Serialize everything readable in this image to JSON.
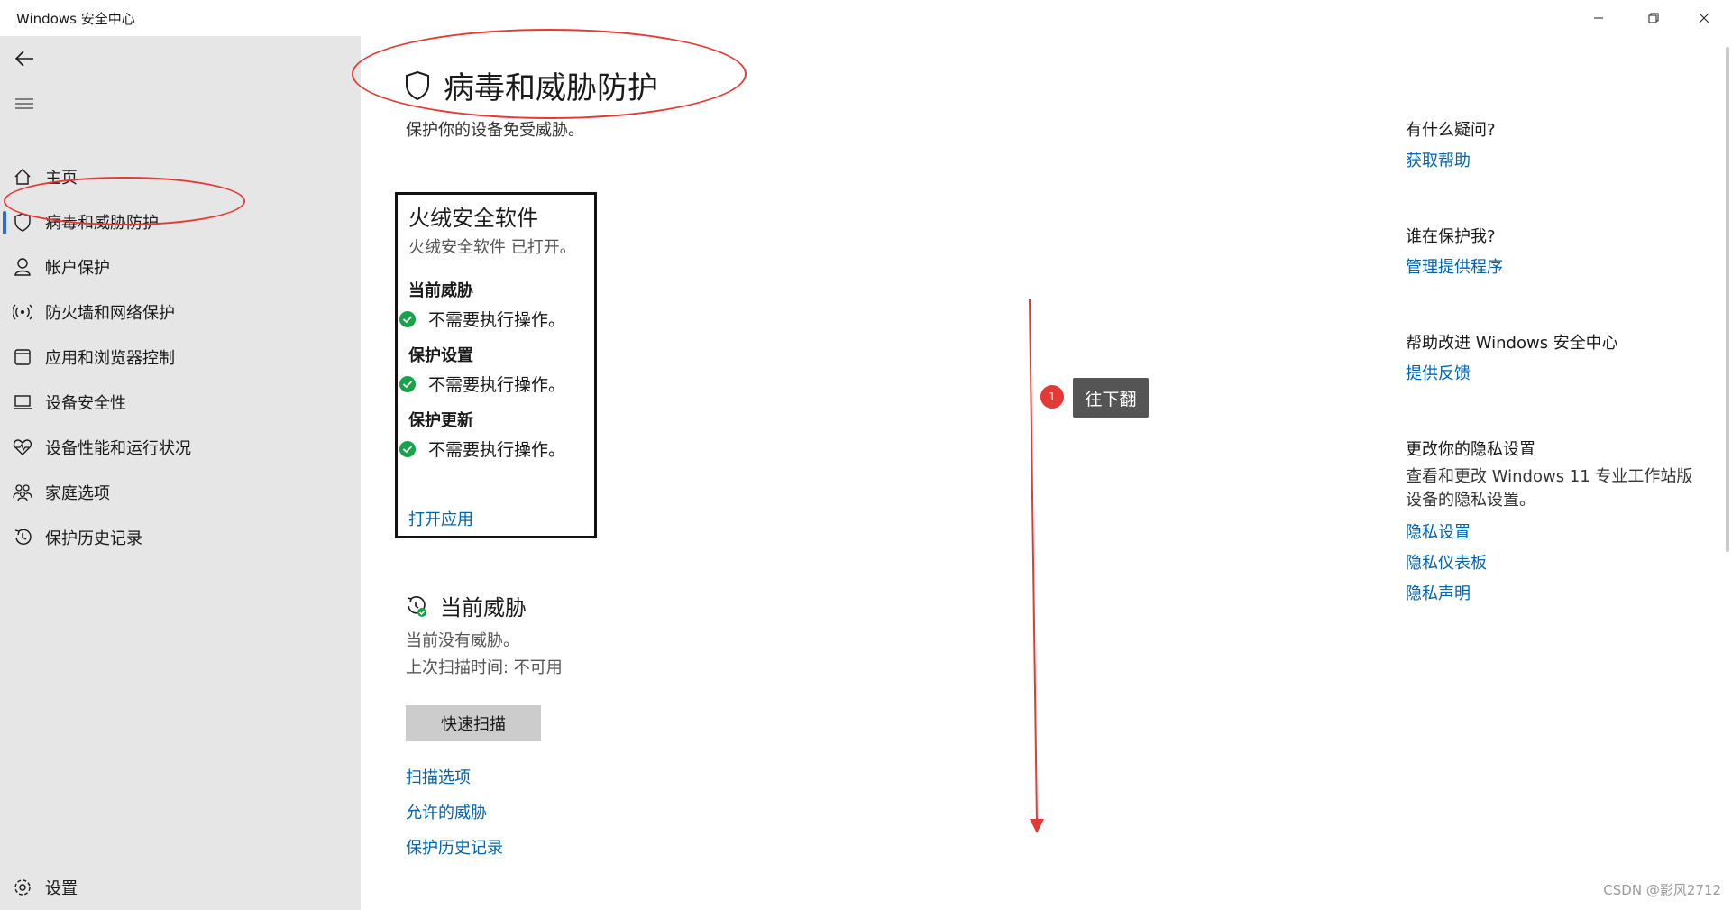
{
  "window": {
    "title": "Windows 安全中心"
  },
  "sidebar": {
    "items": [
      {
        "label": "主页",
        "icon": "home-icon"
      },
      {
        "label": "病毒和威胁防护",
        "icon": "shield-icon",
        "active": true
      },
      {
        "label": "帐户保护",
        "icon": "person-icon"
      },
      {
        "label": "防火墙和网络保护",
        "icon": "wifi-icon"
      },
      {
        "label": "应用和浏览器控制",
        "icon": "app-browser-icon"
      },
      {
        "label": "设备安全性",
        "icon": "laptop-icon"
      },
      {
        "label": "设备性能和运行状况",
        "icon": "heart-pulse-icon"
      },
      {
        "label": "家庭选项",
        "icon": "family-icon"
      },
      {
        "label": "保护历史记录",
        "icon": "history-icon"
      }
    ],
    "settings_label": "设置"
  },
  "main": {
    "title": "病毒和威胁防护",
    "subtitle": "保护你的设备免受威胁。",
    "provider": {
      "name": "火绒安全软件",
      "status": "火绒安全软件 已打开。",
      "sections": [
        {
          "heading": "当前威胁",
          "status": "不需要执行操作。"
        },
        {
          "heading": "保护设置",
          "status": "不需要执行操作。"
        },
        {
          "heading": "保护更新",
          "status": "不需要执行操作。"
        }
      ],
      "open_app_link": "打开应用"
    },
    "threats": {
      "title": "当前威胁",
      "line1": "当前没有威胁。",
      "line2": "上次扫描时间: 不可用",
      "quick_scan": "快速扫描",
      "links": [
        "扫描选项",
        "允许的威胁",
        "保护历史记录"
      ]
    }
  },
  "annotation": {
    "badge": "1",
    "tooltip": "往下翻",
    "color": "#e53935"
  },
  "side": {
    "help": {
      "heading": "有什么疑问?",
      "link": "获取帮助"
    },
    "who": {
      "heading": "谁在保护我?",
      "link": "管理提供程序"
    },
    "improve": {
      "heading": "帮助改进 Windows 安全中心",
      "link": "提供反馈"
    },
    "privacy": {
      "heading": "更改你的隐私设置",
      "desc": "查看和更改 Windows 11 专业工作站版 设备的隐私设置。",
      "links": [
        "隐私设置",
        "隐私仪表板",
        "隐私声明"
      ]
    }
  },
  "watermark": "CSDN @影风2712",
  "colors": {
    "accent": "#2b6ad6",
    "link": "#0063b1",
    "ok_green": "#16a34a",
    "sidebar_bg": "#e6e6e6"
  }
}
